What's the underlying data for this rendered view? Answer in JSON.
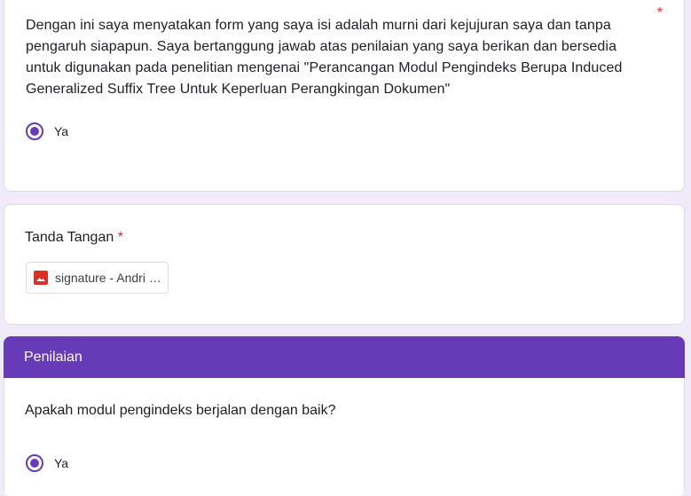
{
  "consent": {
    "question": "Dengan ini saya menyatakan form yang saya isi adalah murni dari kejujuran saya dan tanpa pengaruh siapapun. Saya bertanggung jawab atas penilaian yang saya berikan dan bersedia untuk digunakan pada penelitian mengenai \"Perancangan Modul Pengindeks Berupa Induced Generalized Suffix Tree Untuk Keperluan Perangkingan Dokumen\"",
    "required_mark": "*",
    "option_label": "Ya"
  },
  "signature": {
    "title": "Tanda Tangan",
    "required_mark": "*",
    "file_name": "signature - Andri Mulyana.png",
    "file_icon": "image-file-icon"
  },
  "section": {
    "title": "Penilaian",
    "question": "Apakah modul pengindeks berjalan dengan baik?",
    "option_label": "Ya"
  },
  "colors": {
    "accent": "#673ab7",
    "background": "#f0ebf8",
    "required": "#d93025",
    "file_icon": "#d93025"
  }
}
